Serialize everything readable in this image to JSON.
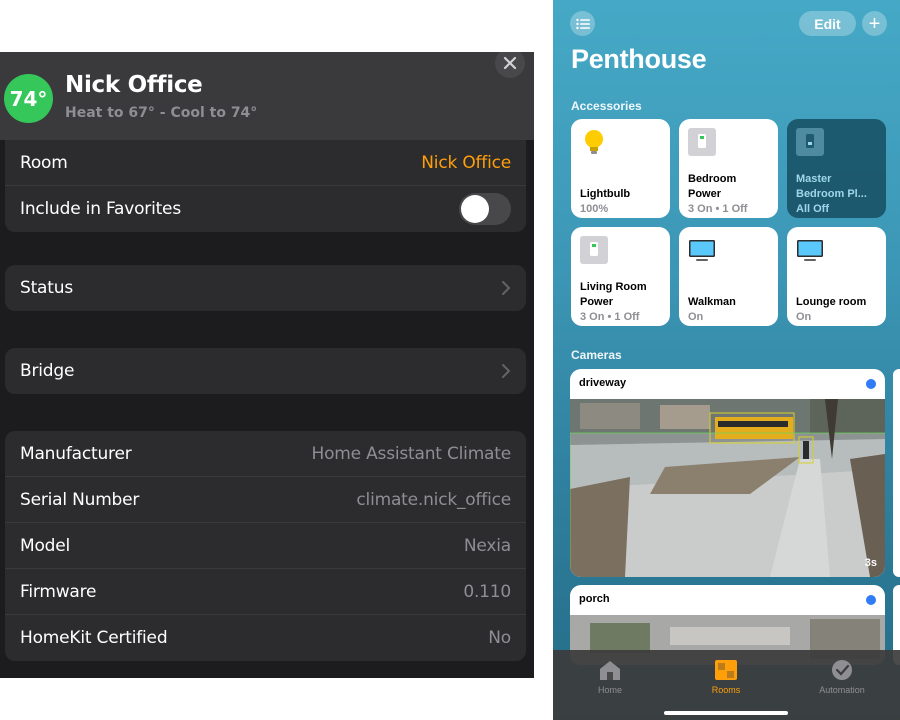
{
  "settings": {
    "header": {
      "temperature": "74°",
      "title": "Nick Office",
      "subtitle": "Heat to 67° - Cool to 74°",
      "close_icon": "close-icon"
    },
    "room": {
      "label": "Room",
      "value": "Nick Office"
    },
    "favorites": {
      "label": "Include in Favorites",
      "enabled": false
    },
    "status": {
      "label": "Status"
    },
    "bridge": {
      "label": "Bridge"
    },
    "info": [
      {
        "label": "Manufacturer",
        "value": "Home Assistant Climate"
      },
      {
        "label": "Serial Number",
        "value": "climate.nick_office"
      },
      {
        "label": "Model",
        "value": "Nexia"
      },
      {
        "label": "Firmware",
        "value": "0.110"
      },
      {
        "label": "HomeKit Certified",
        "value": "No"
      }
    ],
    "colors": {
      "accent": "#ff9f0a",
      "badge": "#35c759",
      "background": "#1c1c1e",
      "cell": "#2c2c2e"
    }
  },
  "home": {
    "edit_label": "Edit",
    "add_label": "+",
    "title": "Penthouse",
    "accessories_label": "Accessories",
    "cameras_label": "Cameras",
    "accessories": [
      {
        "name": "Lightbulb",
        "status": "100%",
        "icon": "lightbulb-icon",
        "on": true
      },
      {
        "name": "Bedroom Power",
        "status": "3 On • 1 Off",
        "icon": "power-strip-icon",
        "on": true
      },
      {
        "name": "Master Bedroom Pl...",
        "status": "All Off",
        "icon": "power-strip-icon",
        "on": false
      },
      {
        "name": "Living Room Power",
        "status": "3 On • 1 Off",
        "icon": "power-strip-icon",
        "on": true
      },
      {
        "name": "Walkman",
        "status": "On",
        "icon": "tv-icon",
        "on": true
      },
      {
        "name": "Lounge room",
        "status": "On",
        "icon": "tv-icon",
        "on": true
      }
    ],
    "cameras": [
      {
        "name": "driveway",
        "age": "3s"
      },
      {
        "name": "porch",
        "age": ""
      }
    ],
    "tabs": [
      {
        "label": "Home",
        "icon": "house-icon",
        "active": false
      },
      {
        "label": "Rooms",
        "icon": "rooms-icon",
        "active": true
      },
      {
        "label": "Automation",
        "icon": "clock-check-icon",
        "active": false
      }
    ],
    "colors": {
      "accent": "#ff9f0a",
      "camera_dot": "#2f7cf6"
    }
  }
}
